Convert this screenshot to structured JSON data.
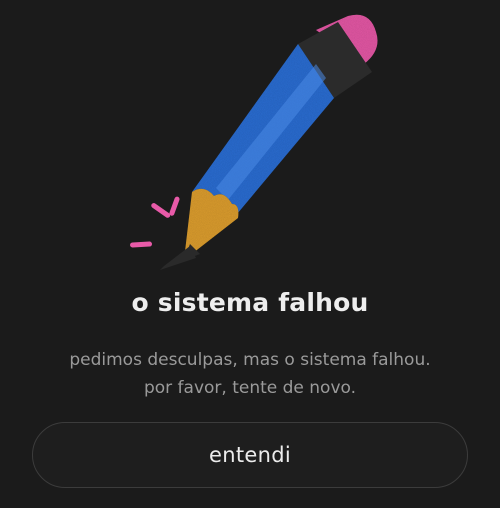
{
  "illustration": {
    "icon": "pencil-icon",
    "colors": {
      "body": "#2f6fd6",
      "eraser": "#e85aa8",
      "tip": "#e0a030",
      "ferrule": "#2a2a2a",
      "sparks": "#e85aa8"
    }
  },
  "dialog": {
    "title": "o sistema falhou",
    "message_line1": "pedimos desculpas, mas o sistema falhou.",
    "message_line2": "por favor, tente de novo.",
    "button_label": "entendi"
  },
  "colors": {
    "background": "#1b1b1b",
    "title": "#eeeeee",
    "message": "#9a9a9a",
    "button_border": "#3c3c3c"
  }
}
